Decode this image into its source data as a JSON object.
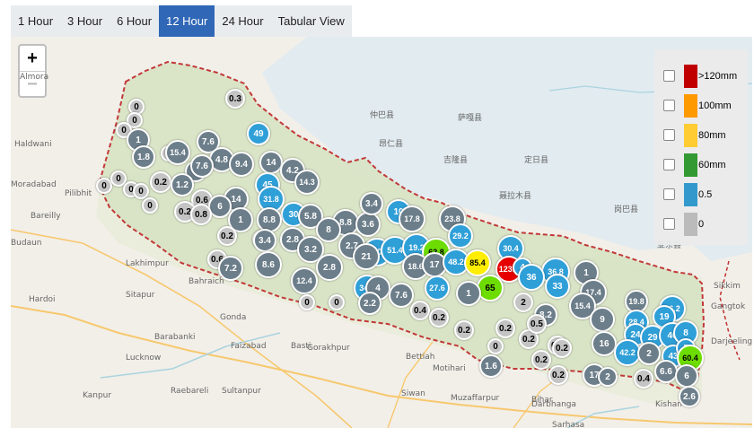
{
  "tabs": [
    {
      "label": "1 Hour",
      "active": false
    },
    {
      "label": "3 Hour",
      "active": false
    },
    {
      "label": "6 Hour",
      "active": false
    },
    {
      "label": "12 Hour",
      "active": true
    },
    {
      "label": "24 Hour",
      "active": false
    },
    {
      "label": "Tabular View",
      "active": false
    }
  ],
  "zoom": {
    "in_label": "+",
    "out_label": "−"
  },
  "legend": [
    {
      "label": ">120mm",
      "color": "#c00000"
    },
    {
      "label": "100mm",
      "color": "#ff9900"
    },
    {
      "label": "80mm",
      "color": "#ffcc33"
    },
    {
      "label": "60mm",
      "color": "#339933"
    },
    {
      "label": "0.5",
      "color": "#3399cc"
    },
    {
      "label": "0",
      "color": "#bbbbbb"
    }
  ],
  "marker_colors": {
    "gray": "#c4c4c4",
    "slate": "#6c7e8a",
    "blue": "#2f9fd8",
    "green": "#6ddc00",
    "yellow": "#ffee00",
    "red": "#e60000"
  },
  "places": [
    "Almora",
    "Haldwani",
    "Moradabad",
    "Pilibhit",
    "Bareilly",
    "Budaun",
    "Lakhimpur",
    "Hardoi",
    "Sitapur",
    "Bahraich",
    "Gonda",
    "Barabanki",
    "Lucknow",
    "Faizabad",
    "Basti",
    "Gorakhpur",
    "Kanpur",
    "Raebareli",
    "Sultanpur",
    "Motihari",
    "Bettiah",
    "Siwan",
    "Muzaffarpur",
    "Darbhanga",
    "Sarhasa",
    "Bihar",
    "Kishan",
    "Gangtok",
    "Sikkim",
    "Darjeeling",
    "仲巴县",
    "萨嘎县",
    "昂仁县",
    "吉隆县",
    "聂拉木县",
    "定日县",
    "岗巴县",
    "亚东县"
  ],
  "markers": [
    {
      "v": "0.3",
      "c": "gray"
    },
    {
      "v": "0",
      "c": "gray"
    },
    {
      "v": "0",
      "c": "gray"
    },
    {
      "v": "0",
      "c": "gray"
    },
    {
      "v": "1",
      "c": "slate"
    },
    {
      "v": "1.8",
      "c": "slate"
    },
    {
      "v": "0",
      "c": "gray"
    },
    {
      "v": "15.4",
      "c": "slate"
    },
    {
      "v": "7.6",
      "c": "slate"
    },
    {
      "v": "49",
      "c": "blue"
    },
    {
      "v": "4.8",
      "c": "slate"
    },
    {
      "v": "9.4",
      "c": "slate"
    },
    {
      "v": "14",
      "c": "slate"
    },
    {
      "v": "8",
      "c": "slate"
    },
    {
      "v": "7.6",
      "c": "slate"
    },
    {
      "v": "4.2",
      "c": "slate"
    },
    {
      "v": "14.3",
      "c": "slate"
    },
    {
      "v": "0",
      "c": "gray"
    },
    {
      "v": "0",
      "c": "gray"
    },
    {
      "v": "0",
      "c": "gray"
    },
    {
      "v": "0",
      "c": "gray"
    },
    {
      "v": "0",
      "c": "gray"
    },
    {
      "v": "0.2",
      "c": "gray"
    },
    {
      "v": "1.2",
      "c": "slate"
    },
    {
      "v": "45",
      "c": "blue"
    },
    {
      "v": "0.6",
      "c": "gray"
    },
    {
      "v": "31.8",
      "c": "blue"
    },
    {
      "v": "14",
      "c": "slate"
    },
    {
      "v": "6",
      "c": "slate"
    },
    {
      "v": "0.2",
      "c": "gray"
    },
    {
      "v": "0.8",
      "c": "gray"
    },
    {
      "v": "30",
      "c": "blue"
    },
    {
      "v": "5.8",
      "c": "slate"
    },
    {
      "v": "1",
      "c": "slate"
    },
    {
      "v": "8.8",
      "c": "slate"
    },
    {
      "v": "8.8",
      "c": "slate"
    },
    {
      "v": "3.6",
      "c": "slate"
    },
    {
      "v": "3.4",
      "c": "slate"
    },
    {
      "v": "10",
      "c": "blue"
    },
    {
      "v": "17.8",
      "c": "slate"
    },
    {
      "v": "23.8",
      "c": "slate"
    },
    {
      "v": "0.2",
      "c": "gray"
    },
    {
      "v": "0.2",
      "c": "gray"
    },
    {
      "v": "3.4",
      "c": "slate"
    },
    {
      "v": "2.8",
      "c": "slate"
    },
    {
      "v": "8",
      "c": "slate"
    },
    {
      "v": "29.2",
      "c": "blue"
    },
    {
      "v": "0.6",
      "c": "gray"
    },
    {
      "v": "3.2",
      "c": "slate"
    },
    {
      "v": "2.7",
      "c": "slate"
    },
    {
      "v": "40",
      "c": "blue"
    },
    {
      "v": "51.4",
      "c": "blue"
    },
    {
      "v": "19.2",
      "c": "blue"
    },
    {
      "v": "62.8",
      "c": "green"
    },
    {
      "v": "30.4",
      "c": "blue"
    },
    {
      "v": "7.2",
      "c": "slate"
    },
    {
      "v": "8.6",
      "c": "slate"
    },
    {
      "v": "2.8",
      "c": "slate"
    },
    {
      "v": "21",
      "c": "slate"
    },
    {
      "v": "18.6",
      "c": "slate"
    },
    {
      "v": "17",
      "c": "slate"
    },
    {
      "v": "48.2",
      "c": "blue"
    },
    {
      "v": "85.4",
      "c": "yellow"
    },
    {
      "v": "123.4",
      "c": "red"
    },
    {
      "v": "4",
      "c": "blue"
    },
    {
      "v": "36.8",
      "c": "blue"
    },
    {
      "v": "1",
      "c": "slate"
    },
    {
      "v": "36",
      "c": "blue"
    },
    {
      "v": "12.4",
      "c": "slate"
    },
    {
      "v": "34.2",
      "c": "blue"
    },
    {
      "v": "4",
      "c": "slate"
    },
    {
      "v": "7.6",
      "c": "slate"
    },
    {
      "v": "27.6",
      "c": "blue"
    },
    {
      "v": "65",
      "c": "green"
    },
    {
      "v": "1",
      "c": "slate"
    },
    {
      "v": "33",
      "c": "blue"
    },
    {
      "v": "17.4",
      "c": "slate"
    },
    {
      "v": "0",
      "c": "gray"
    },
    {
      "v": "0",
      "c": "gray"
    },
    {
      "v": "2.2",
      "c": "slate"
    },
    {
      "v": "0.4",
      "c": "gray"
    },
    {
      "v": "0.2",
      "c": "gray"
    },
    {
      "v": "2",
      "c": "gray"
    },
    {
      "v": "8.2",
      "c": "slate"
    },
    {
      "v": "15.4",
      "c": "slate"
    },
    {
      "v": "19.8",
      "c": "slate"
    },
    {
      "v": "36.2",
      "c": "blue"
    },
    {
      "v": "9",
      "c": "slate"
    },
    {
      "v": "28.4",
      "c": "blue"
    },
    {
      "v": "19",
      "c": "blue"
    },
    {
      "v": "0.2",
      "c": "gray"
    },
    {
      "v": "0.2",
      "c": "gray"
    },
    {
      "v": "0.2",
      "c": "gray"
    },
    {
      "v": "0.2",
      "c": "gray"
    },
    {
      "v": "0.5",
      "c": "gray"
    },
    {
      "v": "24",
      "c": "blue"
    },
    {
      "v": "29",
      "c": "blue"
    },
    {
      "v": "40",
      "c": "blue"
    },
    {
      "v": "8",
      "c": "blue"
    },
    {
      "v": "0",
      "c": "gray"
    },
    {
      "v": "0.2",
      "c": "gray"
    },
    {
      "v": "0.2",
      "c": "gray"
    },
    {
      "v": "16",
      "c": "slate"
    },
    {
      "v": "42.2",
      "c": "blue"
    },
    {
      "v": "2",
      "c": "slate"
    },
    {
      "v": "43",
      "c": "blue"
    },
    {
      "v": "5",
      "c": "blue"
    },
    {
      "v": "60.4",
      "c": "green"
    },
    {
      "v": "1.6",
      "c": "slate"
    },
    {
      "v": "0.2",
      "c": "gray"
    },
    {
      "v": "17",
      "c": "slate"
    },
    {
      "v": "2",
      "c": "slate"
    },
    {
      "v": "0.4",
      "c": "gray"
    },
    {
      "v": "6.6",
      "c": "slate"
    },
    {
      "v": "6",
      "c": "slate"
    },
    {
      "v": "2.6",
      "c": "slate"
    }
  ]
}
